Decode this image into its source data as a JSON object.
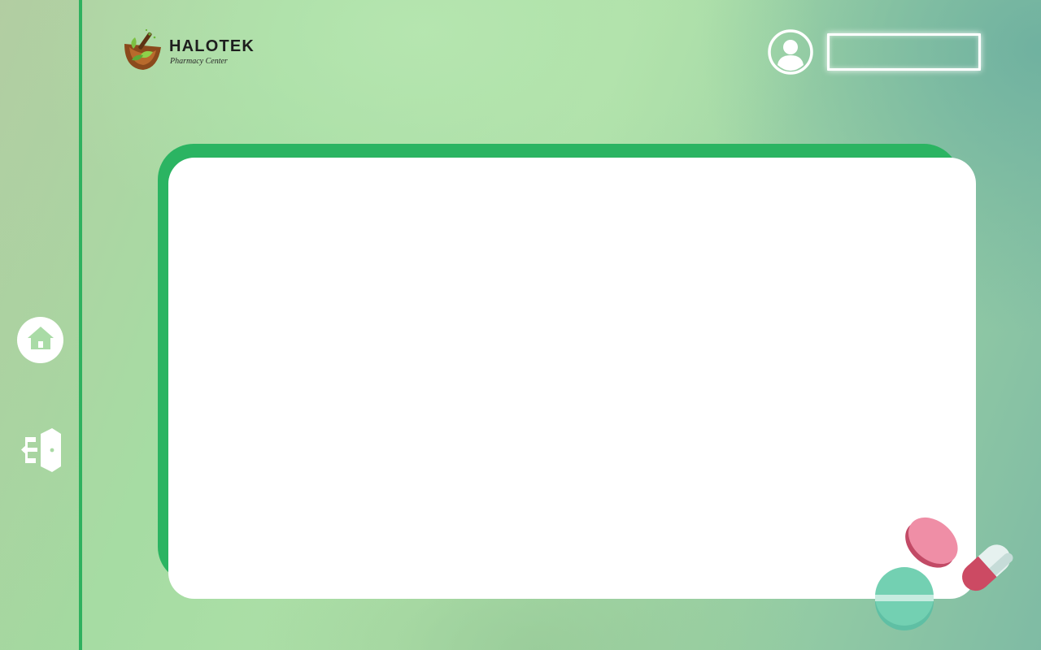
{
  "brand": {
    "name": "HALOTEK",
    "tagline": "Pharmacy Center"
  },
  "header": {
    "avatar_icon": "user-circle-icon",
    "input_value": ""
  },
  "sidebar": {
    "items": [
      {
        "id": "home",
        "icon": "home-icon"
      },
      {
        "id": "logout",
        "icon": "logout-icon"
      }
    ]
  },
  "colors": {
    "accent": "#2bb462",
    "background": "#aee0a8",
    "panel": "#ffffff"
  },
  "decor": {
    "illustration": "pills-illustration"
  }
}
